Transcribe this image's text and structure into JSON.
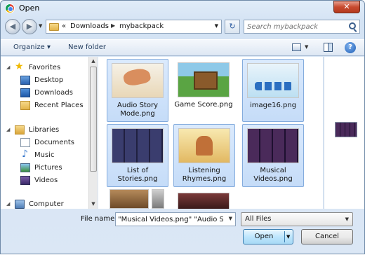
{
  "window": {
    "title": "Open",
    "close_glyph": "✕"
  },
  "nav": {
    "back_glyph": "◀",
    "forward_glyph": "▶",
    "address_chevron": "«",
    "breadcrumbs": [
      "Downloads",
      "mybackpack"
    ],
    "crumb_separator": "▶",
    "refresh_glyph": "↻",
    "search_placeholder": "Search mybackpack"
  },
  "toolbar": {
    "organize_label": "Organize ▾",
    "new_folder_label": "New folder",
    "help_glyph": "?"
  },
  "sidebar": {
    "groups": [
      {
        "label": "Favorites",
        "icon": "star-icon",
        "items": [
          {
            "label": "Desktop",
            "icon": "desktop-icon"
          },
          {
            "label": "Downloads",
            "icon": "downloads-icon"
          },
          {
            "label": "Recent Places",
            "icon": "recent-places-icon"
          }
        ]
      },
      {
        "label": "Libraries",
        "icon": "libraries-icon",
        "items": [
          {
            "label": "Documents",
            "icon": "documents-icon"
          },
          {
            "label": "Music",
            "icon": "music-icon"
          },
          {
            "label": "Pictures",
            "icon": "pictures-icon"
          },
          {
            "label": "Videos",
            "icon": "videos-icon"
          }
        ]
      },
      {
        "label": "Computer",
        "icon": "computer-icon",
        "items": []
      }
    ]
  },
  "files": [
    {
      "name": "Audio Story Mode.png",
      "selected": true
    },
    {
      "name": "Game Score.png",
      "selected": false
    },
    {
      "name": "image16.png",
      "selected": true
    },
    {
      "name": "List of Stories.png",
      "selected": true
    },
    {
      "name": "Listening Rhymes.png",
      "selected": true
    },
    {
      "name": "Musical Videos.png",
      "selected": true
    }
  ],
  "bottom": {
    "filename_label": "File name:",
    "filename_value": "\"Musical Videos.png\" \"Audio Stor",
    "filetype_value": "All Files",
    "open_label": "Open",
    "cancel_label": "Cancel"
  },
  "colors": {
    "selection_fill": "#cce1fa",
    "selection_border": "#84acdd",
    "accent": "#3c7fb1"
  }
}
